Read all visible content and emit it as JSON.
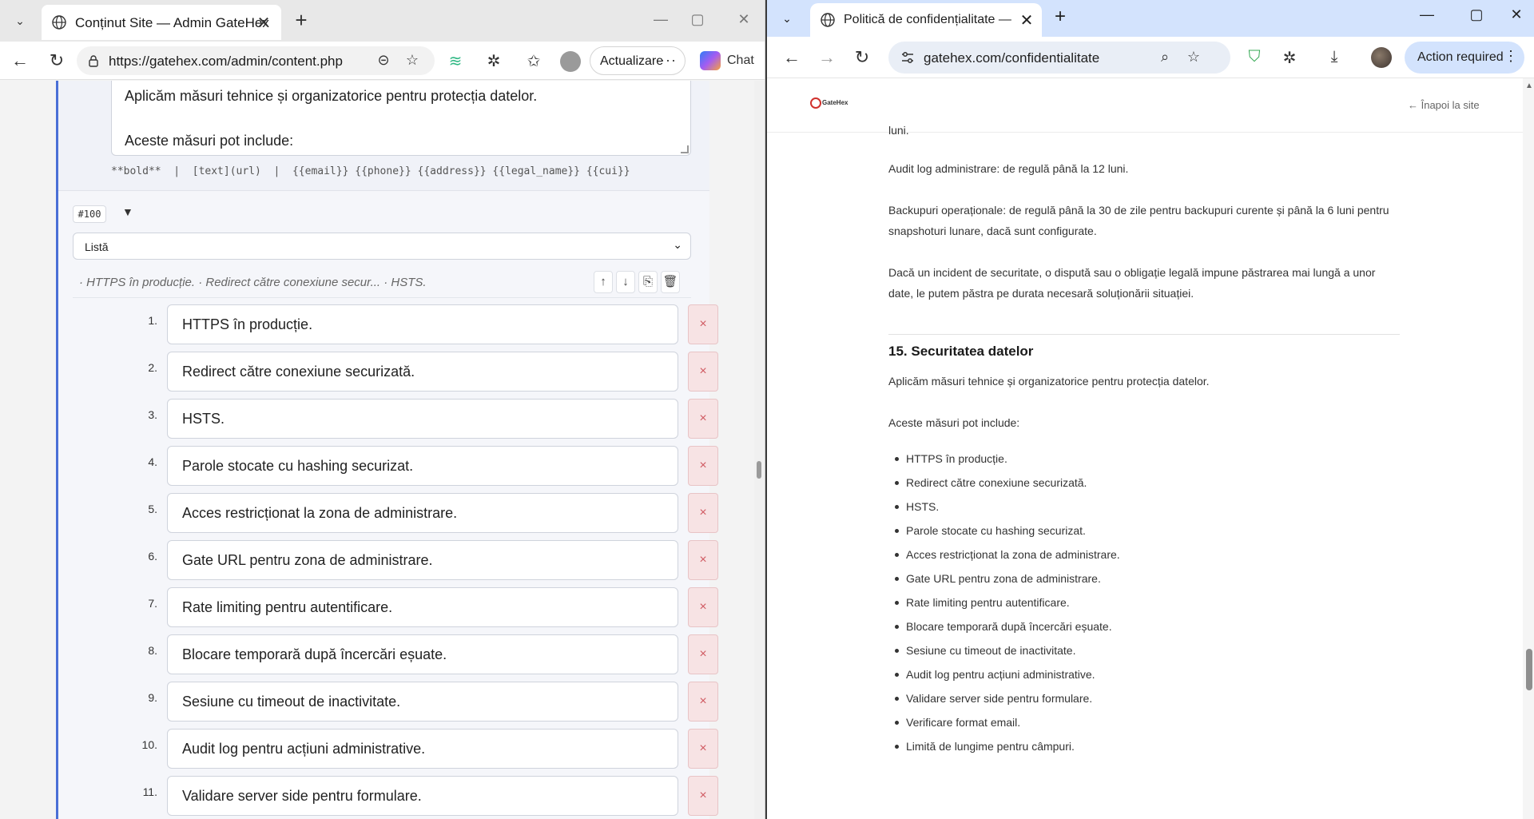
{
  "left_browser": {
    "tab_title": "Conținut Site — Admin GateHex",
    "url": "https://gatehex.com/admin/content.php",
    "update_label": "Actualizare",
    "chat_label": "Chat",
    "editor": {
      "textarea_line1": "Aplicăm măsuri tehnice și organizatorice pentru protecția datelor.",
      "textarea_line2": "Aceste măsuri pot include:",
      "hints": "**bold**  |  [text](url)  |  {{email}} {{phone}} {{address}} {{legal_name}} {{cui}}",
      "item_badge": "#100",
      "caret": "▼",
      "type_value": "Listă",
      "summary": "· HTTPS în producție. · Redirect către conexiune secur... · HSTS.",
      "delete_symbol": "×",
      "items": [
        {
          "num": "1.",
          "text": "HTTPS în producție."
        },
        {
          "num": "2.",
          "text": "Redirect către conexiune securizată."
        },
        {
          "num": "3.",
          "text": "HSTS."
        },
        {
          "num": "4.",
          "text": "Parole stocate cu hashing securizat."
        },
        {
          "num": "5.",
          "text": "Acces restricționat la zona de administrare."
        },
        {
          "num": "6.",
          "text": "Gate URL pentru zona de administrare."
        },
        {
          "num": "7.",
          "text": "Rate limiting pentru autentificare."
        },
        {
          "num": "8.",
          "text": "Blocare temporară după încercări eșuate."
        },
        {
          "num": "9.",
          "text": "Sesiune cu timeout de inactivitate."
        },
        {
          "num": "10.",
          "text": "Audit log pentru acțiuni administrative."
        },
        {
          "num": "11.",
          "text": "Validare server side pentru formulare."
        }
      ]
    }
  },
  "right_browser": {
    "tab_title": "Politică de confidențialitate — G",
    "url": "gatehex.com/confidentialitate",
    "action_label": "Action required",
    "site": {
      "logo_text": "GateHex",
      "back_link": "←  Înapoi la site",
      "para_cut": "luni.",
      "para_audit": "Audit log administrare: de regulă până la 12 luni.",
      "para_backup": "Backupuri operaționale: de regulă până la 30 de zile pentru backupuri curente și până la 6 luni pentru snapshoturi lunare, dacă sunt configurate.",
      "para_incident": "Dacă un incident de securitate, o dispută sau o obligație legală impune păstrarea mai lungă a unor date, le putem păstra pe durata necesară soluționării situației.",
      "section_heading": "15. Securitatea datelor",
      "section_intro": "Aplicăm măsuri tehnice și organizatorice pentru protecția datelor.",
      "section_lead": "Aceste măsuri pot include:",
      "bullets": [
        "HTTPS în producție.",
        "Redirect către conexiune securizată.",
        "HSTS.",
        "Parole stocate cu hashing securizat.",
        "Acces restricționat la zona de administrare.",
        "Gate URL pentru zona de administrare.",
        "Rate limiting pentru autentificare.",
        "Blocare temporară după încercări eșuate.",
        "Sesiune cu timeout de inactivitate.",
        "Audit log pentru acțiuni administrative.",
        "Validare server side pentru formulare.",
        "Verificare format email.",
        "Limită de lungime pentru câmpuri."
      ]
    }
  }
}
